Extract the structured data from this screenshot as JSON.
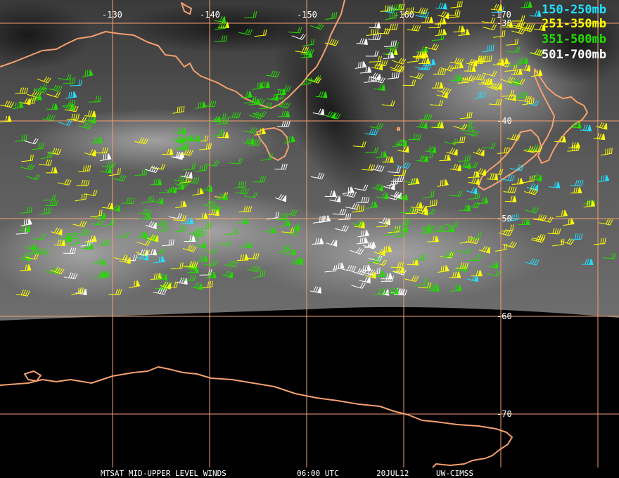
{
  "legend": [
    {
      "label": "150-250mb",
      "color": "#22e0ff"
    },
    {
      "label": "251-350mb",
      "color": "#ffff00"
    },
    {
      "label": "351-500mb",
      "color": "#22dd00"
    },
    {
      "label": "501-700mb",
      "color": "#ffffff"
    }
  ],
  "longitude_labels": [
    "-130",
    "-140",
    "-150",
    "-160",
    "-170"
  ],
  "latitude_labels": [
    "-30",
    "-40",
    "-50",
    "-60",
    "-70"
  ],
  "footer": {
    "product": "MTSAT MID-UPPER LEVEL WINDS",
    "time": "06:00 UTC",
    "date": "20JUL12",
    "source": "UW-CIMSS"
  },
  "colors": {
    "coastline": "#f4a070",
    "grid": "#f4a070",
    "background": "#000000"
  }
}
